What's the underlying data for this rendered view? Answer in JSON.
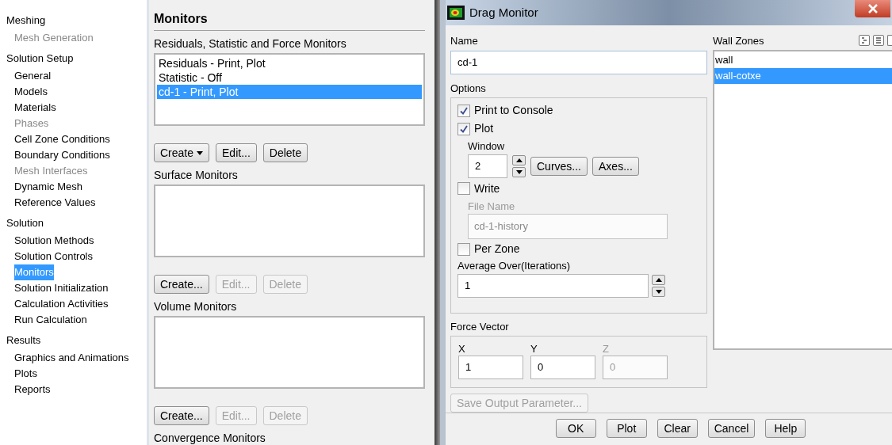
{
  "tree": [
    {
      "label": "Meshing",
      "children": [
        {
          "label": "Mesh Generation",
          "disabled": true,
          "selected": false
        }
      ]
    },
    {
      "label": "Solution Setup",
      "children": [
        {
          "label": "General",
          "disabled": false,
          "selected": false
        },
        {
          "label": "Models",
          "disabled": false,
          "selected": false
        },
        {
          "label": "Materials",
          "disabled": false,
          "selected": false
        },
        {
          "label": "Phases",
          "disabled": true,
          "selected": false
        },
        {
          "label": "Cell Zone Conditions",
          "disabled": false,
          "selected": false
        },
        {
          "label": "Boundary Conditions",
          "disabled": false,
          "selected": false
        },
        {
          "label": "Mesh Interfaces",
          "disabled": true,
          "selected": false
        },
        {
          "label": "Dynamic Mesh",
          "disabled": false,
          "selected": false
        },
        {
          "label": "Reference Values",
          "disabled": false,
          "selected": false
        }
      ]
    },
    {
      "label": "Solution",
      "children": [
        {
          "label": "Solution Methods",
          "disabled": false,
          "selected": false
        },
        {
          "label": "Solution Controls",
          "disabled": false,
          "selected": false
        },
        {
          "label": "Monitors",
          "disabled": false,
          "selected": true
        },
        {
          "label": "Solution Initialization",
          "disabled": false,
          "selected": false
        },
        {
          "label": "Calculation Activities",
          "disabled": false,
          "selected": false
        },
        {
          "label": "Run Calculation",
          "disabled": false,
          "selected": false
        }
      ]
    },
    {
      "label": "Results",
      "children": [
        {
          "label": "Graphics and Animations",
          "disabled": false,
          "selected": false
        },
        {
          "label": "Plots",
          "disabled": false,
          "selected": false
        },
        {
          "label": "Reports",
          "disabled": false,
          "selected": false
        }
      ]
    }
  ],
  "monitors_panel": {
    "title": "Monitors",
    "sections": [
      {
        "label": "Residuals, Statistic and Force Monitors",
        "items": [
          {
            "label": "Residuals - Print, Plot",
            "selected": false
          },
          {
            "label": "Statistic - Off",
            "selected": false
          },
          {
            "label": "cd-1 - Print, Plot",
            "selected": true
          }
        ],
        "buttons": [
          {
            "label": "Create",
            "disabled": false,
            "dropdown": true
          },
          {
            "label": "Edit...",
            "disabled": false,
            "dropdown": false
          },
          {
            "label": "Delete",
            "disabled": false,
            "dropdown": false
          }
        ]
      },
      {
        "label": "Surface Monitors",
        "buttons": [
          {
            "label": "Create...",
            "disabled": false,
            "dropdown": false
          },
          {
            "label": "Edit...",
            "disabled": true,
            "dropdown": false
          },
          {
            "label": "Delete",
            "disabled": true,
            "dropdown": false
          }
        ]
      },
      {
        "label": "Volume Monitors",
        "buttons": [
          {
            "label": "Create...",
            "disabled": false,
            "dropdown": false
          },
          {
            "label": "Edit...",
            "disabled": true,
            "dropdown": false
          },
          {
            "label": "Delete",
            "disabled": true,
            "dropdown": false
          }
        ]
      },
      {
        "label": "Convergence Monitors"
      }
    ]
  },
  "dialog": {
    "title": "Drag Monitor",
    "name": {
      "label": "Name",
      "value": "cd-1"
    },
    "options": {
      "label": "Options",
      "print_to_console": {
        "label": "Print to Console",
        "checked": true
      },
      "plot": {
        "label": "Plot",
        "checked": true
      },
      "window": {
        "label": "Window",
        "value": "2"
      },
      "curves_button": "Curves...",
      "axes_button": "Axes...",
      "write": {
        "label": "Write",
        "checked": false
      },
      "file_name": {
        "label": "File Name",
        "value": "cd-1-history",
        "disabled": true
      },
      "per_zone": {
        "label": "Per Zone",
        "checked": false
      },
      "average_over": {
        "label": "Average Over(Iterations)",
        "value": "1"
      }
    },
    "force_vector": {
      "label": "Force Vector",
      "components": [
        {
          "label": "X",
          "value": "1",
          "disabled": false
        },
        {
          "label": "Y",
          "value": "0",
          "disabled": false
        },
        {
          "label": "Z",
          "value": "0",
          "disabled": true
        }
      ]
    },
    "save_output_button": {
      "label": "Save Output Parameter...",
      "disabled": true
    },
    "wall_zones": {
      "label": "Wall Zones",
      "items": [
        {
          "label": "wall",
          "selected": false
        },
        {
          "label": "wall-cotxe",
          "selected": true
        }
      ]
    },
    "buttons": [
      "OK",
      "Plot",
      "Clear",
      "Cancel",
      "Help"
    ]
  }
}
